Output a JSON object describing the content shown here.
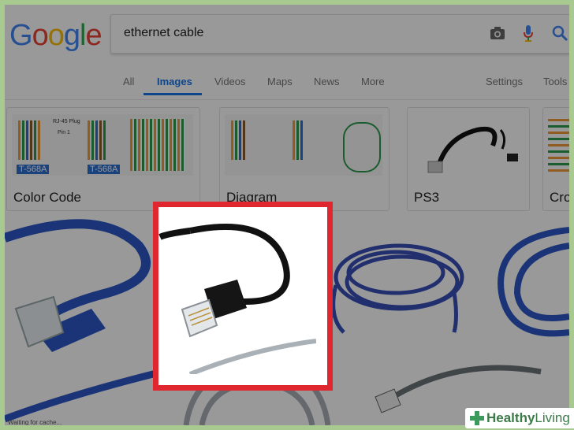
{
  "logo": {
    "letters": [
      "G",
      "o",
      "o",
      "g",
      "l",
      "e"
    ]
  },
  "search": {
    "query": "ethernet cable"
  },
  "tabs": [
    {
      "label": "All"
    },
    {
      "label": "Images"
    },
    {
      "label": "Videos"
    },
    {
      "label": "Maps"
    },
    {
      "label": "News"
    },
    {
      "label": "More"
    }
  ],
  "tools": {
    "settings": "Settings",
    "tools": "Tools"
  },
  "chips": [
    {
      "label": "Color Code"
    },
    {
      "label": "Diagram"
    },
    {
      "label": "PS3"
    },
    {
      "label": "Cro"
    }
  ],
  "diagram_text": {
    "plug": "RJ-45 Plug",
    "pin": "Pin 1",
    "std1": "T-568A",
    "std2": "T-568A"
  },
  "status": {
    "text": "Waiting for cache..."
  },
  "brand": {
    "name_bold": "Healthy",
    "name_light": "Living"
  },
  "colors": {
    "highlight": "#e0262f",
    "accent": "#1a73e8",
    "brand": "#3b9a5c"
  }
}
